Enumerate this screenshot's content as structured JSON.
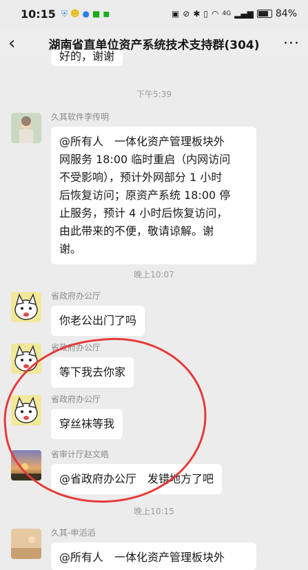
{
  "status_bar": {
    "time": "10:15",
    "battery": "84%",
    "network": "4G"
  },
  "header": {
    "title": "湖南省直单位资产系统技术支持群(304)"
  },
  "prev_message_tail": "好的，谢谢",
  "timestamps": [
    "下午5:39",
    "晚上10:07",
    "晚上10:15"
  ],
  "messages": [
    {
      "sender": "久其软件李传明",
      "text": "@所有人　一体化资产管理板块外\n网服务 18:00 临时重启（内网访问\n不受影响），预计外网部分 1 小时\n后恢复访问；原资产系统 18:00 停\n止服务，预计 4 小时后恢复访问，\n由此带来的不便，敬请谅解。谢\n谢。"
    },
    {
      "sender": "省政府办公厅",
      "text": "你老公出门了吗"
    },
    {
      "sender": "省政府办公厅",
      "text": "等下我去你家"
    },
    {
      "sender": "省政府办公厅",
      "text": "穿丝袜等我"
    },
    {
      "sender": "省审计厅赵文皓",
      "text": "@省政府办公厅　发错地方了吧"
    },
    {
      "sender": "久其-申滔滔",
      "text": "@所有人　一体化资产管理板块外"
    }
  ],
  "colors": {
    "background": "#ececec",
    "bubble": "#ffffff",
    "annotation_circle": "#e53a3a"
  }
}
